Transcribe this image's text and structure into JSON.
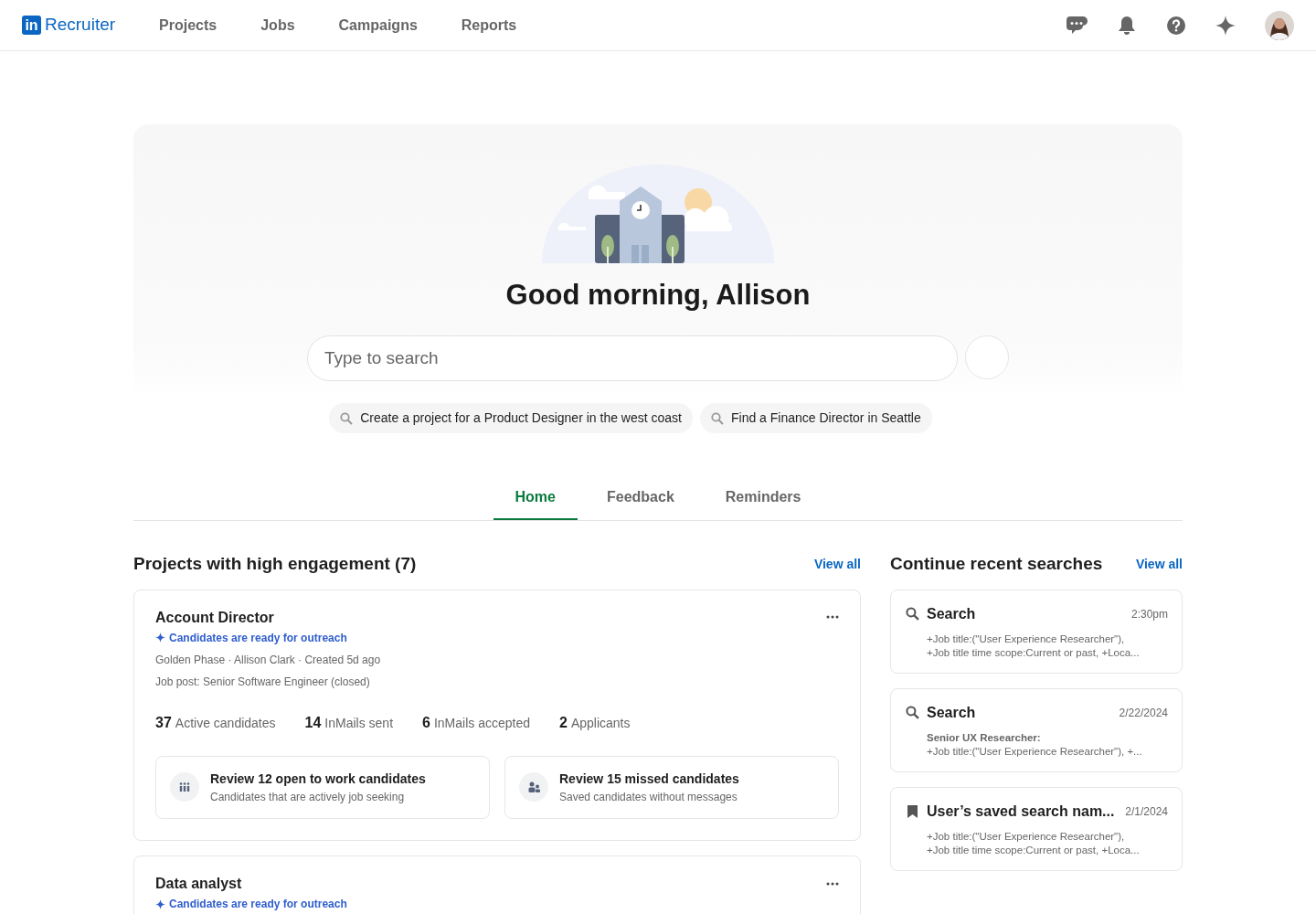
{
  "navbar": {
    "logo_mark": "in",
    "logo_text": "Recruiter",
    "items": [
      "Projects",
      "Jobs",
      "Campaigns",
      "Reports"
    ],
    "actions": [
      {
        "kind": "messages"
      },
      {
        "kind": "notifications"
      },
      {
        "kind": "help"
      },
      {
        "kind": "ai"
      },
      {
        "kind": "avatar"
      }
    ]
  },
  "hero": {
    "greeting": "Good morning, Allison",
    "search": {
      "placeholder": "Type to search"
    },
    "suggestions": [
      "Create a project for a Product Designer in the west coast",
      "Find a Finance Director in Seattle"
    ]
  },
  "tabs": [
    {
      "label": "Home",
      "selected": true
    },
    {
      "label": "Feedback",
      "selected": false
    },
    {
      "label": "Reminders",
      "selected": false
    }
  ],
  "projects": {
    "title": "Projects with high engagement (7)",
    "view_all": "View all",
    "items": [
      {
        "title": "Account Director",
        "highlight": "Candidates are ready for outreach",
        "meta": [
          "Golden Phase · Allison Clark · Created 5d ago",
          "Job post: Senior Software Engineer (closed)"
        ],
        "stats": [
          {
            "value": "37",
            "label": "Active candidates"
          },
          {
            "value": "14",
            "label": "InMails sent"
          },
          {
            "value": "6",
            "label": "InMails accepted"
          },
          {
            "value": "2",
            "label": "Applicants"
          }
        ],
        "actions": [
          {
            "kind": "open_to_work",
            "title": "Review 12 open to work candidates",
            "subtitle": "Candidates that are actively job seeking"
          },
          {
            "kind": "missed",
            "title": "Review 15 missed candidates",
            "subtitle": "Saved candidates without messages"
          }
        ]
      },
      {
        "title": "Data analyst",
        "highlight": "Candidates are ready for outreach"
      }
    ]
  },
  "recent_searches": {
    "title": "Continue recent searches",
    "view_all": "View all",
    "items": [
      {
        "kind": "search",
        "title": "Search",
        "time": "2:30pm",
        "lines": [
          "+Job title:(\"User Experience Researcher\"),",
          "+Job title time scope:Current or past, +Loca..."
        ]
      },
      {
        "kind": "search",
        "title": "Search",
        "time": "2/22/2024",
        "lines": [
          "**Senior UX Researcher:**",
          "+Job title:(\"User Experience Researcher\"), +..."
        ]
      },
      {
        "kind": "saved",
        "title": "User’s saved search nam...",
        "time": "2/1/2024",
        "lines": [
          "+Job title:(\"User Experience Researcher\"),",
          "+Job title time scope:Current or past, +Loca..."
        ]
      }
    ]
  }
}
